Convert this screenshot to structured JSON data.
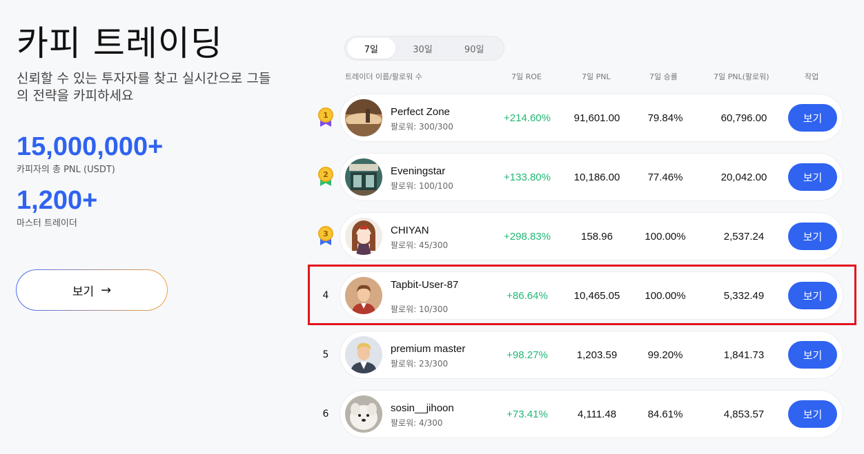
{
  "hero": {
    "title": "카피 트레이딩",
    "subtitle": "신뢰할 수 있는 투자자를 찾고 실시간으로 그들의 전략을 카피하세요",
    "stats": [
      {
        "value": "15,000,000+",
        "label": "카피자의 총 PNL (USDT)"
      },
      {
        "value": "1,200+",
        "label": "마스터 트레이더"
      }
    ],
    "view_button": "보기",
    "view_button_arrow": "→"
  },
  "tabs": [
    {
      "label": "7일",
      "active": true
    },
    {
      "label": "30일",
      "active": false
    },
    {
      "label": "90일",
      "active": false
    }
  ],
  "table": {
    "headers": {
      "name": "트레이더 이름/팔로워 수",
      "roe": "7일 ROE",
      "pnl": "7일 PNL",
      "winrate": "7일 승률",
      "follower_pnl": "7일 PNL(팔로워)",
      "action": "작업"
    },
    "rows": [
      {
        "rank": "1",
        "medal": true,
        "name": "Perfect Zone",
        "followers": "팔로워: 300/300",
        "roe": "+214.60%",
        "pnl": "91,601.00",
        "winrate": "79.84%",
        "follower_pnl": "60,796.00",
        "action": "보기",
        "avatar": "landscape-avatar"
      },
      {
        "rank": "2",
        "medal": true,
        "name": "Eveningstar",
        "followers": "팔로워: 100/100",
        "roe": "+133.80%",
        "pnl": "10,186.00",
        "winrate": "77.46%",
        "follower_pnl": "20,042.00",
        "action": "보기",
        "avatar": "storefront-avatar"
      },
      {
        "rank": "3",
        "medal": true,
        "name": "CHIYAN",
        "followers": "팔로워: 45/300",
        "roe": "+298.83%",
        "pnl": "158.96",
        "winrate": "100.00%",
        "follower_pnl": "2,537.24",
        "action": "보기",
        "avatar": "anime-girl-avatar"
      },
      {
        "rank": "4",
        "medal": false,
        "name": "Tapbit-User-87",
        "followers": "팔로워: 10/300",
        "roe": "+86.64%",
        "pnl": "10,465.05",
        "winrate": "100.00%",
        "follower_pnl": "5,332.49",
        "action": "보기",
        "avatar": "default-user-avatar"
      },
      {
        "rank": "5",
        "medal": false,
        "name": "premium master",
        "followers": "팔로워: 23/300",
        "roe": "+98.27%",
        "pnl": "1,203.59",
        "winrate": "99.20%",
        "follower_pnl": "1,841.73",
        "action": "보기",
        "avatar": "suit-man-avatar"
      },
      {
        "rank": "6",
        "medal": false,
        "name": "sosin__jihoon",
        "followers": "팔로워: 4/300",
        "roe": "+73.41%",
        "pnl": "4,111.48",
        "winrate": "84.61%",
        "follower_pnl": "4,853.57",
        "action": "보기",
        "avatar": "white-dog-avatar"
      }
    ]
  },
  "colors": {
    "accent": "#2f63f0",
    "positive": "#1fb873",
    "highlight": "#e3151f",
    "medal_gold": "#f7c531",
    "ribbon_1": "#7a4cf0",
    "ribbon_2": "#2bbf6a",
    "ribbon_3": "#3b6cf6"
  }
}
